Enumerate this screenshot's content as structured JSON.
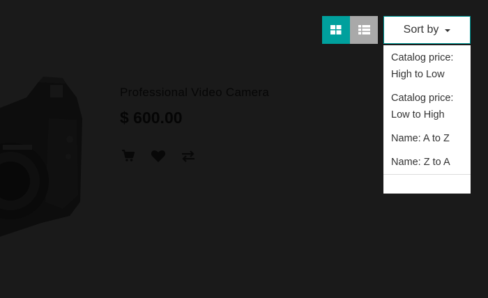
{
  "product": {
    "name": "Professional Video Camera",
    "price": "$ 600.00",
    "image_icon": "camera-image",
    "actions": [
      {
        "name": "add-to-cart-icon",
        "icon": "cart"
      },
      {
        "name": "wishlist-icon",
        "icon": "heart"
      },
      {
        "name": "compare-icon",
        "icon": "exchange-arrows"
      }
    ]
  },
  "view_toggle": {
    "grid_icon": "grid-icon",
    "list_icon": "list-icon",
    "active": "grid"
  },
  "sort": {
    "label": "Sort by",
    "options": [
      {
        "line1": "Catalog price:",
        "line2": "High to Low"
      },
      {
        "line1": "Catalog price:",
        "line2": "Low to High"
      },
      {
        "line1": "Name: A to Z"
      },
      {
        "line1": "Name: Z to A"
      }
    ]
  },
  "colors": {
    "background": "#1a1a1a",
    "accent": "#00a09d",
    "inactive_toggle": "#a9a9a9",
    "menu_background": "#ffffff",
    "menu_text": "#333333"
  }
}
